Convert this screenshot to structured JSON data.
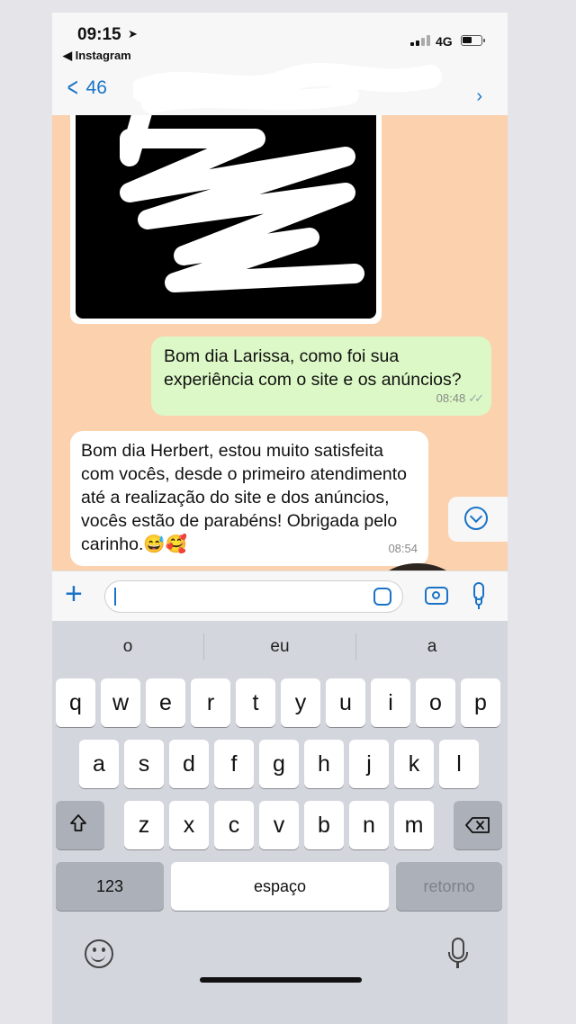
{
  "status": {
    "time": "09:15",
    "back_app": "◀ Instagram",
    "network": "4G",
    "battery_level": 0.55
  },
  "nav": {
    "back_count": "46"
  },
  "messages": {
    "outgoing_1": {
      "text": "Bom dia Larissa, como foi sua experiência com o site e os anúncios?",
      "time": "08:48",
      "ticks": "✓✓"
    },
    "incoming_1": {
      "text": "Bom dia Herbert, estou muito satisfeita com vocês, desde o primeiro atendimento até a realização do site e dos anúncios, vocês estão de parabéns! Obrigada pelo carinho.😅🥰",
      "time": "08:54"
    }
  },
  "keyboard": {
    "suggestions": [
      "o",
      "eu",
      "a"
    ],
    "row1": [
      "q",
      "w",
      "e",
      "r",
      "t",
      "y",
      "u",
      "i",
      "o",
      "p"
    ],
    "row2": [
      "a",
      "s",
      "d",
      "f",
      "g",
      "h",
      "j",
      "k",
      "l"
    ],
    "row3": [
      "z",
      "x",
      "c",
      "v",
      "b",
      "n",
      "m"
    ],
    "numbers_label": "123",
    "space_label": "espaço",
    "return_label": "retorno"
  },
  "colors": {
    "accent": "#1a73c7",
    "chat_bg": "#fbd1ae",
    "outgoing_bubble": "#dcf8c6"
  }
}
